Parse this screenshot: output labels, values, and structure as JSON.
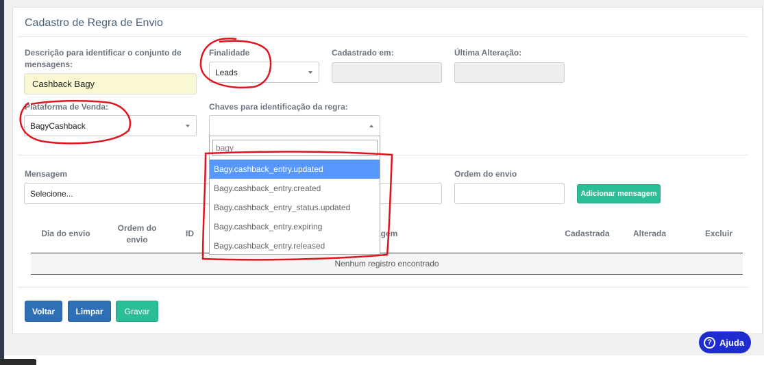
{
  "form": {
    "title": "Cadastro de Regra de Envio",
    "descricao": {
      "label": "Descrição para identificar o conjunto de mensagens:",
      "value": "Cashback Bagy"
    },
    "finalidade": {
      "label": "Finalidade",
      "value": "Leads"
    },
    "cadastrado_em": {
      "label": "Cadastrado em:",
      "value": ""
    },
    "ultima_alteracao": {
      "label": "Última Alteração:",
      "value": ""
    },
    "plataforma": {
      "label": "Plataforma de Venda:",
      "value": "BagyCashback"
    },
    "chaves": {
      "label": "Chaves para identificação da regra:",
      "value": ""
    },
    "mensagem": {
      "label": "Mensagem",
      "value": "Selecione..."
    },
    "ordem_envio": {
      "label": "Ordem do envio",
      "value": ""
    },
    "add_button": "Adicionar mensagem"
  },
  "dropdown": {
    "search_value": "bagy",
    "options": [
      "Bagy.cashback_entry.updated",
      "Bagy.cashback_entry.created",
      "Bagy.cashback_entry_status.updated",
      "Bagy.cashback_entry.expiring",
      "Bagy.cashback_entry.released"
    ],
    "highlighted_index": 0
  },
  "table": {
    "columns": [
      "Dia do envio",
      "Ordem do envio",
      "ID",
      "agem",
      "Cadastrada",
      "Alterada",
      "Excluir"
    ],
    "empty_message": "Nenhum registro encontrado"
  },
  "actions": {
    "voltar": "Voltar",
    "limpar": "Limpar",
    "gravar": "Gravar"
  },
  "help": {
    "label": "Ajuda",
    "icon": "question-circle-icon"
  },
  "colors": {
    "primary": "#2f6fb5",
    "success": "#2bbd95",
    "highlight": "#5897fb",
    "annotation": "#e0141e",
    "help": "#1f2ccf"
  }
}
